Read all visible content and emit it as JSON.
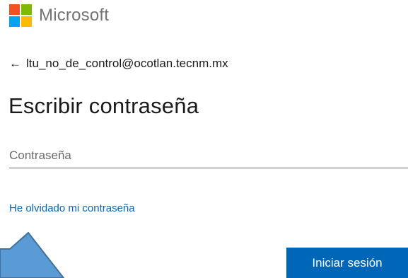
{
  "brand": {
    "name": "Microsoft",
    "logo_colors": [
      "#f25022",
      "#7fba00",
      "#00a4ef",
      "#ffb900"
    ]
  },
  "identity": {
    "back_icon": "back-arrow-icon",
    "back_glyph": "←",
    "email": "ltu_no_de_control@ocotlan.tecnm.mx"
  },
  "title": "Escribir contraseña",
  "password": {
    "placeholder": "Contraseña",
    "value": ""
  },
  "forgot_link": "He olvidado mi contraseña",
  "signin_button": "Iniciar sesión",
  "colors": {
    "accent": "#0067b8",
    "annotation_arrow_fill": "#5b9bd5",
    "annotation_arrow_stroke": "#41719c"
  }
}
